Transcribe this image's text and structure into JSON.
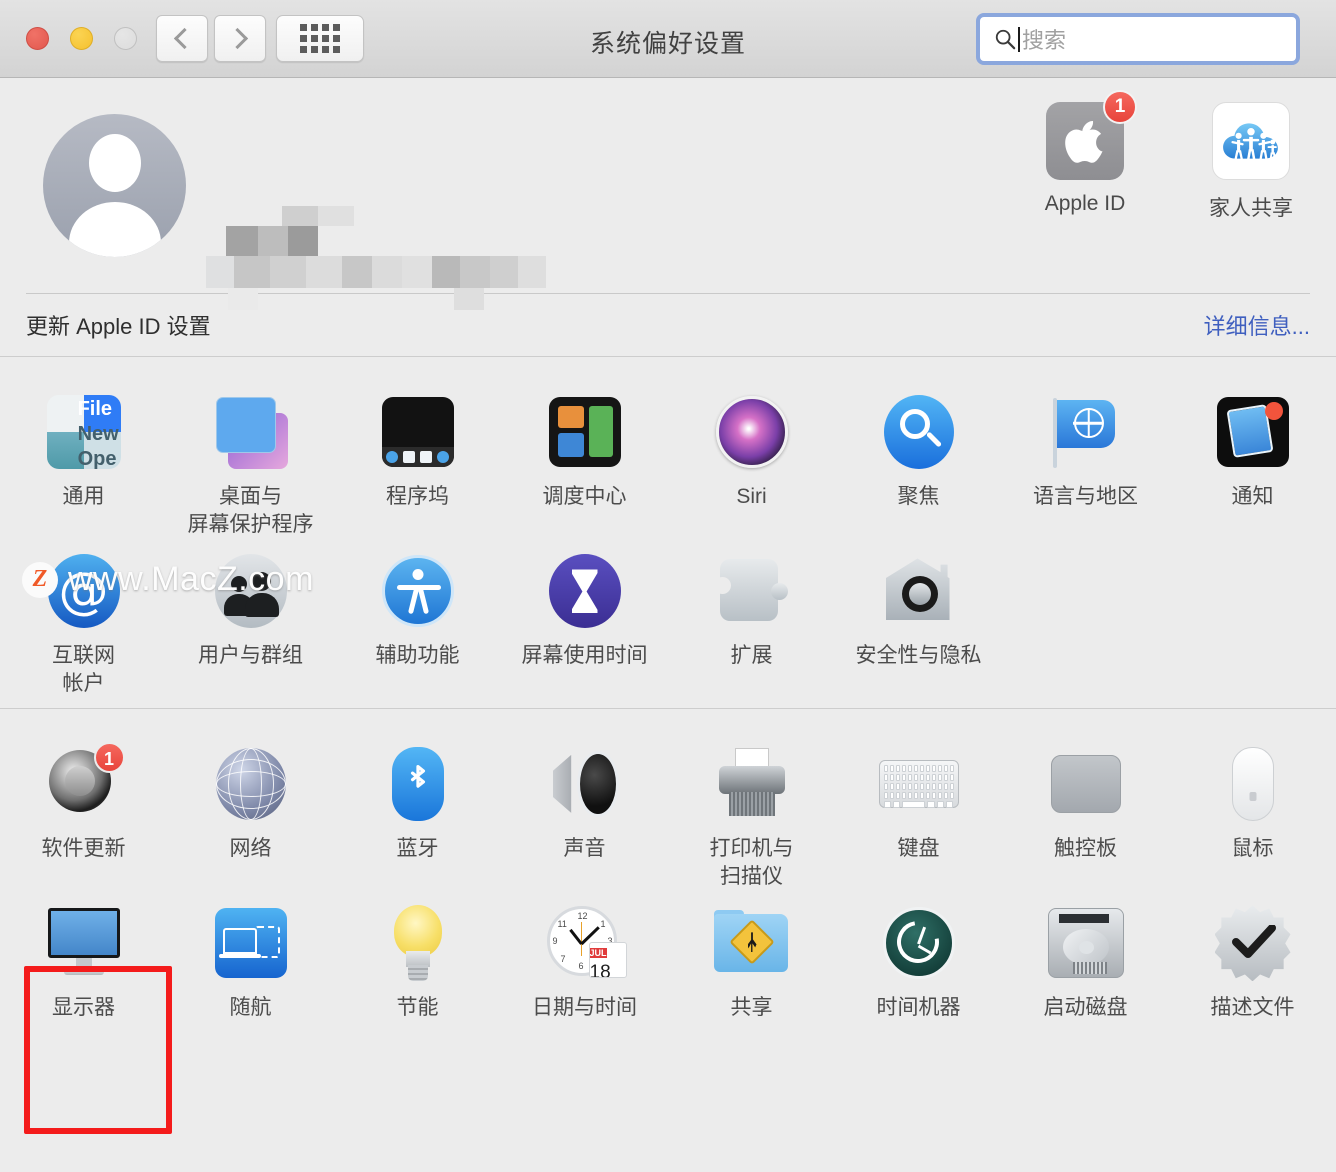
{
  "window": {
    "title": "系统偏好设置",
    "traffic_lights": [
      "close",
      "minimize",
      "zoom-disabled"
    ],
    "nav": {
      "back": "‹",
      "forward": "›",
      "grid": "show-all"
    }
  },
  "search": {
    "placeholder": "搜索",
    "value": "",
    "icon": "search-icon",
    "focused": true
  },
  "account": {
    "avatar": "default-user-avatar",
    "name_redacted": true,
    "icons": [
      {
        "label": "Apple ID",
        "icon": "apple-logo-icon",
        "badge": "1"
      },
      {
        "label": "家人共享",
        "icon": "family-sharing-cloud-icon",
        "badge": ""
      }
    ]
  },
  "update_strip": {
    "message": "更新 Apple ID 设置",
    "link": "详细信息..."
  },
  "watermark": {
    "logo_letter": "Z",
    "text": "www.MacZ.com"
  },
  "sections": [
    {
      "name": "personal",
      "rows": [
        [
          {
            "label": "通用",
            "icon": "general-icon"
          },
          {
            "label": "桌面与\n屏幕保护程序",
            "icon": "desktop-screensaver-icon"
          },
          {
            "label": "程序坞",
            "icon": "dock-icon"
          },
          {
            "label": "调度中心",
            "icon": "mission-control-icon"
          },
          {
            "label": "Siri",
            "icon": "siri-icon"
          },
          {
            "label": "聚焦",
            "icon": "spotlight-icon"
          },
          {
            "label": "语言与地区",
            "icon": "language-region-flag-icon"
          },
          {
            "label": "通知",
            "icon": "notifications-icon"
          }
        ],
        [
          {
            "label": "互联网\n帐户",
            "icon": "internet-accounts-at-icon"
          },
          {
            "label": "用户与群组",
            "icon": "users-groups-icon"
          },
          {
            "label": "辅助功能",
            "icon": "accessibility-icon"
          },
          {
            "label": "屏幕使用时间",
            "icon": "screen-time-hourglass-icon"
          },
          {
            "label": "扩展",
            "icon": "extensions-puzzle-icon"
          },
          {
            "label": "安全性与隐私",
            "icon": "security-privacy-house-icon"
          },
          {
            "label": "",
            "icon": ""
          },
          {
            "label": "",
            "icon": ""
          }
        ]
      ]
    },
    {
      "name": "hardware",
      "rows": [
        [
          {
            "label": "软件更新",
            "icon": "software-update-gear-icon",
            "badge": "1"
          },
          {
            "label": "网络",
            "icon": "network-globe-icon"
          },
          {
            "label": "蓝牙",
            "icon": "bluetooth-icon"
          },
          {
            "label": "声音",
            "icon": "sound-speaker-icon"
          },
          {
            "label": "打印机与\n扫描仪",
            "icon": "printers-scanners-icon"
          },
          {
            "label": "键盘",
            "icon": "keyboard-icon"
          },
          {
            "label": "触控板",
            "icon": "trackpad-icon"
          },
          {
            "label": "鼠标",
            "icon": "mouse-icon"
          }
        ],
        [
          {
            "label": "显示器",
            "icon": "displays-icon",
            "highlighted": true
          },
          {
            "label": "随航",
            "icon": "sidecar-icon"
          },
          {
            "label": "节能",
            "icon": "energy-saver-bulb-icon"
          },
          {
            "label": "日期与时间",
            "icon": "date-time-clock-icon",
            "calendar_month": "JUL",
            "calendar_day": "18"
          },
          {
            "label": "共享",
            "icon": "sharing-folder-icon"
          },
          {
            "label": "时间机器",
            "icon": "time-machine-icon"
          },
          {
            "label": "启动磁盘",
            "icon": "startup-disk-icon"
          },
          {
            "label": "描述文件",
            "icon": "profiles-badge-icon"
          }
        ]
      ]
    }
  ]
}
